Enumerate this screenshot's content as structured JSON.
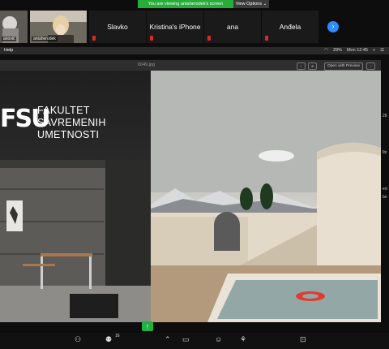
{
  "banner": {
    "message": "You are viewing antaherodek's screen",
    "view_options": "View Options ⌄"
  },
  "participants": [
    {
      "name": "anović",
      "video": true
    },
    {
      "name": "antaherodek",
      "video": true
    },
    {
      "name": "Slavko",
      "video": false
    },
    {
      "name": "Kristina's iPhone",
      "video": false
    },
    {
      "name": "ana",
      "video": false
    },
    {
      "name": "Anđela",
      "video": false
    }
  ],
  "menubar": {
    "help": "Help",
    "battery": "29%",
    "clock": "Mon 12:45"
  },
  "preview": {
    "filename": "0049.jpg",
    "open_with": "Open with Preview",
    "logo_mark": "FSU",
    "logo_lines": [
      "FAKULTET",
      "SAVREMENIH",
      "UMETNOSTI"
    ]
  },
  "side_text": [
    "28",
    "Ibr",
    "ert",
    "be"
  ],
  "toolbar": {
    "participants_count": "16"
  },
  "colors": {
    "banner_green": "#27ae3a",
    "zoom_blue": "#2d8cff",
    "mic_red": "#d92b2b"
  }
}
